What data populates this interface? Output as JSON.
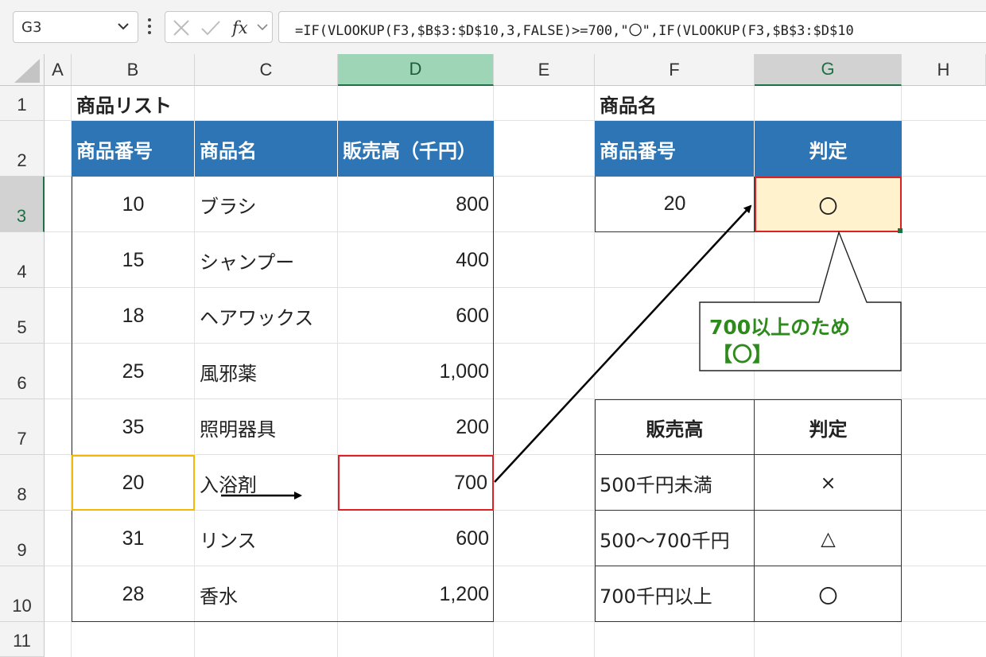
{
  "name_box": {
    "value": "G3"
  },
  "formula_bar": {
    "formula": "=IF(VLOOKUP(F3,$B$3:$D$10,3,FALSE)>=700,\"〇\",IF(VLOOKUP(F3,$B$3:$D$10"
  },
  "columns": [
    "A",
    "B",
    "C",
    "D",
    "E",
    "F",
    "G",
    "H"
  ],
  "rows": [
    "1",
    "2",
    "3",
    "4",
    "5",
    "6",
    "7",
    "8",
    "9",
    "10",
    "11"
  ],
  "product_list": {
    "title": "商品リスト",
    "headers": [
      "商品番号",
      "商品名",
      "販売高（千円）"
    ],
    "items": [
      {
        "id": "10",
        "name": "ブラシ",
        "sales": "800"
      },
      {
        "id": "15",
        "name": "シャンプー",
        "sales": "400"
      },
      {
        "id": "18",
        "name": "ヘアワックス",
        "sales": "600"
      },
      {
        "id": "25",
        "name": "風邪薬",
        "sales": "1,000"
      },
      {
        "id": "35",
        "name": "照明器具",
        "sales": "200"
      },
      {
        "id": "20",
        "name": "入浴剤",
        "sales": "700"
      },
      {
        "id": "31",
        "name": "リンス",
        "sales": "600"
      },
      {
        "id": "28",
        "name": "香水",
        "sales": "1,200"
      }
    ]
  },
  "lookup": {
    "title": "商品名",
    "headers": [
      "商品番号",
      "判定"
    ],
    "id": "20",
    "result": "〇"
  },
  "judgement_table": {
    "headers": [
      "販売高",
      "判定"
    ],
    "rows": [
      {
        "range": "500千円未満",
        "mark": "×"
      },
      {
        "range": "500〜700千円",
        "mark": "△"
      },
      {
        "range": "700千円以上",
        "mark": "〇"
      }
    ]
  },
  "callout": {
    "line1": "700以上のため",
    "line2": "【〇】"
  },
  "colors": {
    "header_blue": "#2e75b6",
    "highlight_red": "#e02020",
    "highlight_orange": "#f5b800",
    "result_fill": "#fff2cc",
    "callout_green": "#2f8a1e",
    "selection_green": "#1e7145"
  }
}
